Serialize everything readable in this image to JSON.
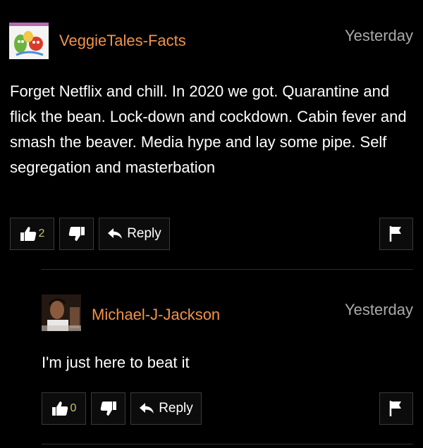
{
  "comments": [
    {
      "username": "VeggieTales-Facts",
      "time": "Yesterday",
      "text": "Forget Netflix and chill. In 2020 we got. Quarantine and flick the bean. Lock-down and cockdown. Cabin fever and smash the beaver. Media hype and lay some pipe. Self segregation and masterbation",
      "likes": "2",
      "reply_label": "Reply",
      "icons": {
        "like": "thumbs-up-icon",
        "dislike": "thumbs-down-icon",
        "reply": "reply-arrow-icon",
        "flag": "flag-icon"
      }
    },
    {
      "username": "Michael-J-Jackson",
      "time": "Yesterday",
      "text": "I'm just here to beat it",
      "likes": "0",
      "reply_label": "Reply",
      "icons": {
        "like": "thumbs-up-icon",
        "dislike": "thumbs-down-icon",
        "reply": "reply-arrow-icon",
        "flag": "flag-icon"
      }
    }
  ],
  "colors": {
    "background": "#000000",
    "username": "#f1934a",
    "timestamp": "#aaaaaa",
    "count": "#c9c36a"
  }
}
